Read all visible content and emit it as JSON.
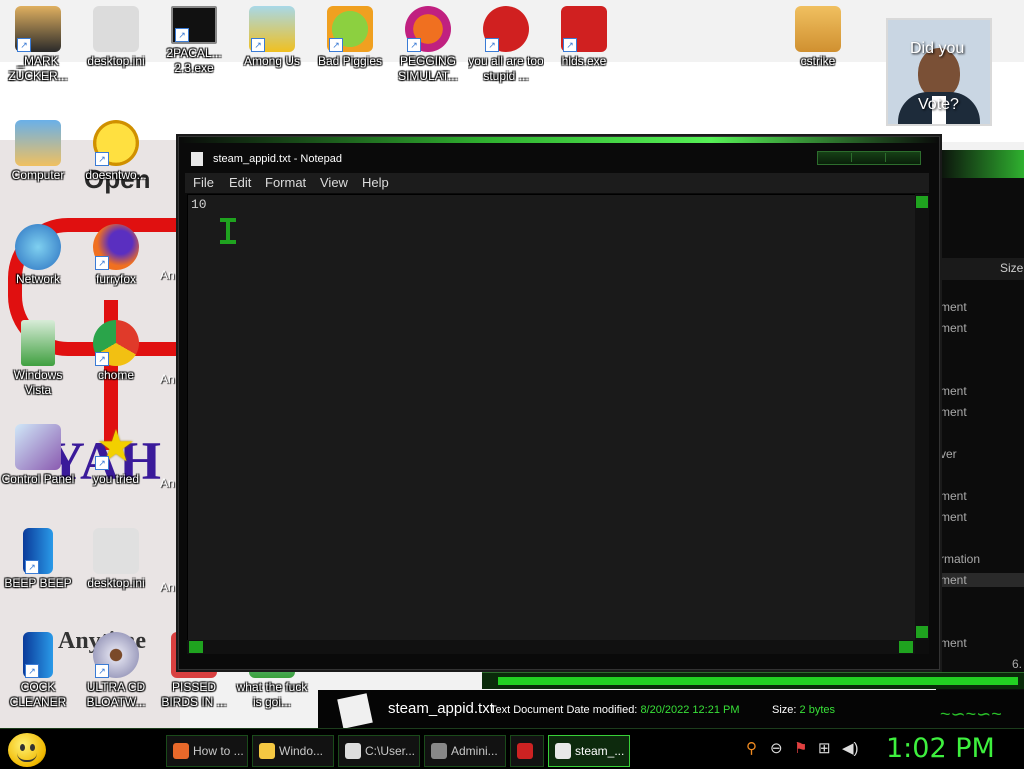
{
  "desktop": {
    "top_icons": [
      {
        "label": "_MARK ZUCKER..."
      },
      {
        "label": "desktop.ini"
      },
      {
        "label": "2PACAL... 2.3.exe"
      },
      {
        "label": "Among Us"
      },
      {
        "label": "Bad Piggies"
      },
      {
        "label": "PEGGING SIMULAT..."
      },
      {
        "label": "you all are too stupid ..."
      },
      {
        "label": "hlds.exe"
      },
      {
        "label": "cstrike"
      }
    ],
    "left_icons": [
      {
        "label": "Computer"
      },
      {
        "label": "doesntwo..."
      },
      {
        "label": "Network"
      },
      {
        "label": "furryfox"
      },
      {
        "label": "Windows Vista"
      },
      {
        "label": "chome"
      },
      {
        "label": "Control Panel"
      },
      {
        "label": "you tried"
      },
      {
        "label": "BEEP BEEP"
      },
      {
        "label": "desktop.ini"
      },
      {
        "label": "COCK CLEANER"
      },
      {
        "label": "ULTRA CD BLOATW..."
      },
      {
        "label": "PISSED BIRDS IN ..."
      },
      {
        "label": "what the fuck is goi..."
      }
    ],
    "partial_icon_labels": [
      "An S",
      "An",
      "An St",
      "An Sl"
    ],
    "photo_widget": {
      "line1": "Did you",
      "line2": "Vote?"
    },
    "bg_fragments": {
      "open": "Open",
      "yahoo": "YAH",
      "anytime": "Anytime"
    },
    "right_window_rows": [
      "ment",
      "ment",
      "ment",
      "ment",
      "ver",
      "ment",
      "ment",
      "rmation",
      "ment",
      "ment"
    ],
    "right_window_size_header": "Size",
    "right_window_num": "6."
  },
  "details_pane": {
    "filename": "steam_appid.txt",
    "type": "Text Document",
    "date_label": "Date modified:",
    "date_value": "8/20/2022 12:21 PM",
    "size_label": "Size:",
    "size_value": "2 bytes"
  },
  "notepad": {
    "title": "steam_appid.txt - Notepad",
    "menu": [
      "File",
      "Edit",
      "Format",
      "View",
      "Help"
    ],
    "content": "10"
  },
  "taskbar": {
    "buttons": [
      {
        "label": "How to ...",
        "color": "#e8692a"
      },
      {
        "label": "Windo...",
        "color": "#f4c842"
      },
      {
        "label": "C:\\User...",
        "color": "#dddddd"
      },
      {
        "label": "Admini...",
        "color": "#888888"
      },
      {
        "label": "",
        "color": "#cc2222"
      },
      {
        "label": "steam_...",
        "color": "#e8e8e8"
      }
    ],
    "clock": "1:02 PM"
  },
  "colors": {
    "accent_green": "#3ef03e",
    "title_green": "#2fb02f"
  }
}
